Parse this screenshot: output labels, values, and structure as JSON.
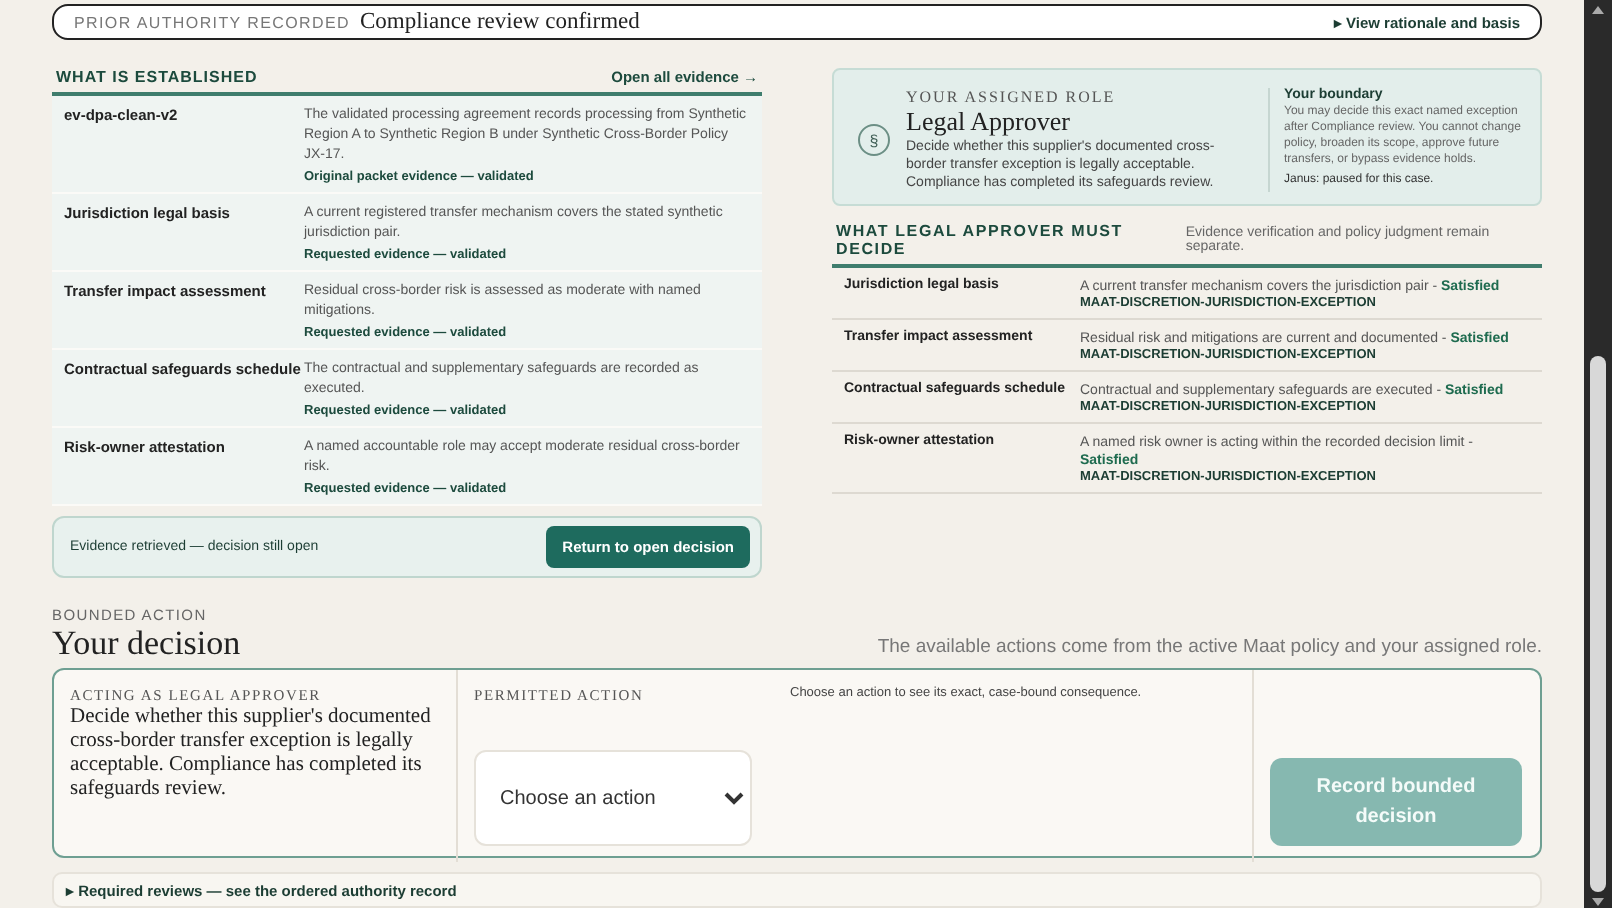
{
  "banner": {
    "label": "PRIOR AUTHORITY RECORDED",
    "title": "Compliance review confirmed",
    "link_marker": "▸",
    "link": "View rationale and basis"
  },
  "established": {
    "heading": "WHAT IS ESTABLISHED",
    "link": "Open all evidence →",
    "rows": [
      {
        "name": "ev-dpa-clean-v2",
        "text": "The validated processing agreement records processing from Synthetic Region A to Synthetic Region B under Synthetic Cross-Border Policy JX-17.",
        "status": "Original packet evidence — validated"
      },
      {
        "name": "Jurisdiction legal basis",
        "text": "A current registered transfer mechanism covers the stated synthetic jurisdiction pair.",
        "status": "Requested evidence — validated"
      },
      {
        "name": "Transfer impact assessment",
        "text": "Residual cross-border risk is assessed as moderate with named mitigations.",
        "status": "Requested evidence — validated"
      },
      {
        "name": "Contractual safeguards schedule",
        "text": "The contractual and supplementary safeguards are recorded as executed.",
        "status": "Requested evidence — validated"
      },
      {
        "name": "Risk-owner attestation",
        "text": "A named accountable role may accept moderate residual cross-border risk.",
        "status": "Requested evidence — validated"
      }
    ],
    "footer": {
      "text": "Evidence retrieved — decision still open",
      "button": "Return to open decision"
    }
  },
  "role": {
    "icon": "§",
    "eyebrow": "YOUR ASSIGNED ROLE",
    "title": "Legal Approver",
    "text": "Decide whether this supplier's documented cross-border transfer exception is legally acceptable. Compliance has completed its safeguards review.",
    "boundary": {
      "heading": "Your boundary",
      "text": "You may decide this exact named exception after Compliance review. You cannot change policy, broaden its scope, approve future transfers, or bypass evidence holds.",
      "note": "Janus: paused for this case."
    }
  },
  "must_decide": {
    "heading": "WHAT LEGAL APPROVER MUST DECIDE",
    "note": "Evidence verification and policy judgment remain separate.",
    "rows": [
      {
        "name": "Jurisdiction legal basis",
        "text": "A current transfer mechanism covers the jurisdiction pair -",
        "result": "Satisfied",
        "code": "MAAT-DISCRETION-JURISDICTION-EXCEPTION"
      },
      {
        "name": "Transfer impact assessment",
        "text": "Residual risk and mitigations are current and documented -",
        "result": "Satisfied",
        "code": "MAAT-DISCRETION-JURISDICTION-EXCEPTION"
      },
      {
        "name": "Contractual safeguards schedule",
        "text": "Contractual and supplementary safeguards are executed -",
        "result": "Satisfied",
        "code": "MAAT-DISCRETION-JURISDICTION-EXCEPTION"
      },
      {
        "name": "Risk-owner attestation",
        "text": "A named risk owner is acting within the recorded decision limit -",
        "result": "Satisfied",
        "code": "MAAT-DISCRETION-JURISDICTION-EXCEPTION"
      }
    ]
  },
  "decision": {
    "eyebrow": "BOUNDED ACTION",
    "title": "Your decision",
    "note": "The available actions come from the active Maat policy and your assigned role.",
    "acting_label": "ACTING AS LEGAL APPROVER",
    "acting_text": "Decide whether this supplier's documented cross-border transfer exception is legally acceptable. Compliance has completed its safeguards review.",
    "action_label": "PERMITTED ACTION",
    "select": {
      "placeholder": "Choose an action"
    },
    "hint": "Choose an action to see its exact, case-bound consequence.",
    "submit": {
      "label": "Record bounded decision",
      "disabled": true
    }
  },
  "reviews": {
    "marker": "▸",
    "text": "Required reviews — see the ordered authority record"
  }
}
